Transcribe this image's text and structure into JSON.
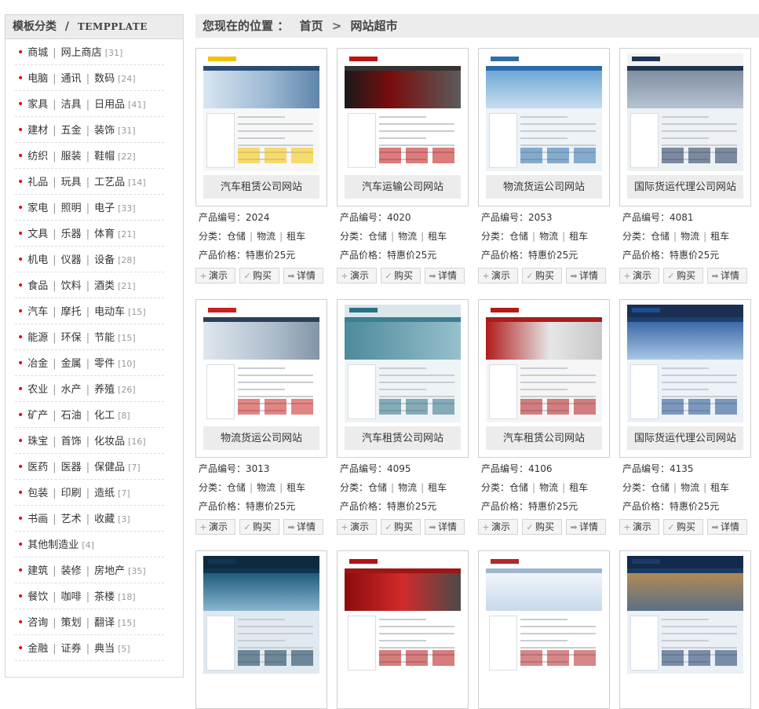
{
  "sidebar": {
    "title_cn": "模板分类",
    "title_sep": "/",
    "title_en": "TEMPPLATE",
    "categories": [
      {
        "names": [
          "商城",
          "网上商店"
        ],
        "count": "[31]"
      },
      {
        "names": [
          "电脑",
          "通讯",
          "数码"
        ],
        "count": "[24]"
      },
      {
        "names": [
          "家具",
          "洁具",
          "日用品"
        ],
        "count": "[41]"
      },
      {
        "names": [
          "建材",
          "五金",
          "装饰"
        ],
        "count": "[31]"
      },
      {
        "names": [
          "纺织",
          "服装",
          "鞋帽"
        ],
        "count": "[22]"
      },
      {
        "names": [
          "礼品",
          "玩具",
          "工艺品"
        ],
        "count": "[14]"
      },
      {
        "names": [
          "家电",
          "照明",
          "电子"
        ],
        "count": "[33]"
      },
      {
        "names": [
          "文具",
          "乐器",
          "体育"
        ],
        "count": "[21]"
      },
      {
        "names": [
          "机电",
          "仪器",
          "设备"
        ],
        "count": "[28]"
      },
      {
        "names": [
          "食品",
          "饮料",
          "酒类"
        ],
        "count": "[21]"
      },
      {
        "names": [
          "汽车",
          "摩托",
          "电动车"
        ],
        "count": "[15]"
      },
      {
        "names": [
          "能源",
          "环保",
          "节能"
        ],
        "count": "[15]"
      },
      {
        "names": [
          "冶金",
          "金属",
          "零件"
        ],
        "count": "[10]"
      },
      {
        "names": [
          "农业",
          "水产",
          "养殖"
        ],
        "count": "[26]"
      },
      {
        "names": [
          "矿产",
          "石油",
          "化工"
        ],
        "count": "[8]"
      },
      {
        "names": [
          "珠宝",
          "首饰",
          "化妆品"
        ],
        "count": "[16]"
      },
      {
        "names": [
          "医药",
          "医器",
          "保健品"
        ],
        "count": "[7]"
      },
      {
        "names": [
          "包装",
          "印刷",
          "造纸"
        ],
        "count": "[7]"
      },
      {
        "names": [
          "书画",
          "艺术",
          "收藏"
        ],
        "count": "[3]"
      },
      {
        "names": [
          "其他制造业"
        ],
        "count": "[4]"
      },
      {
        "names": [
          "建筑",
          "装修",
          "房地产"
        ],
        "count": "[35]"
      },
      {
        "names": [
          "餐饮",
          "咖啡",
          "茶楼"
        ],
        "count": "[18]"
      },
      {
        "names": [
          "咨询",
          "策划",
          "翻译"
        ],
        "count": "[15]"
      },
      {
        "names": [
          "金融",
          "证券",
          "典当"
        ],
        "count": "[5]"
      }
    ]
  },
  "breadcrumb": {
    "label": "您现在的位置 ：",
    "home": "首页",
    "separator": ">",
    "current": "网站超市"
  },
  "info_labels": {
    "code_prefix": "产品编号：",
    "category_prefix": "分类：",
    "category_items": [
      "仓储",
      "物流",
      "租车"
    ],
    "price_prefix": "产品价格：",
    "price_value": "特惠价25元"
  },
  "buttons": {
    "demo": "演示",
    "buy": "购买",
    "detail": "详情",
    "demo_icon": "plus-icon",
    "buy_icon": "check-icon",
    "detail_icon": "arrow-right-icon"
  },
  "products": [
    {
      "title": "汽车租赁公司网站",
      "code": "2024",
      "theme": "car-rental-yellow"
    },
    {
      "title": "汽车运输公司网站",
      "code": "4020",
      "theme": "truck-red"
    },
    {
      "title": "物流货运公司网站",
      "code": "2053",
      "theme": "logistics-blue"
    },
    {
      "title": "国际货运代理公司网站",
      "code": "4081",
      "theme": "shipping-navy"
    },
    {
      "title": "物流货运公司网站",
      "code": "3013",
      "theme": "truck-white"
    },
    {
      "title": "汽车租赁公司网站",
      "code": "4095",
      "theme": "bus-teal"
    },
    {
      "title": "汽车租赁公司网站",
      "code": "4106",
      "theme": "car-rental-red"
    },
    {
      "title": "国际货运代理公司网站",
      "code": "4135",
      "theme": "shipping-blue"
    },
    {
      "title": "",
      "code": "",
      "theme": "airport-dark"
    },
    {
      "title": "",
      "code": "",
      "theme": "truck-red-2"
    },
    {
      "title": "",
      "code": "",
      "theme": "ship-white"
    },
    {
      "title": "",
      "code": "",
      "theme": "warehouse-navy"
    }
  ],
  "colors": {
    "bullet": "#e60012",
    "header_bg": "#ececec",
    "border": "#cfcfcf"
  }
}
